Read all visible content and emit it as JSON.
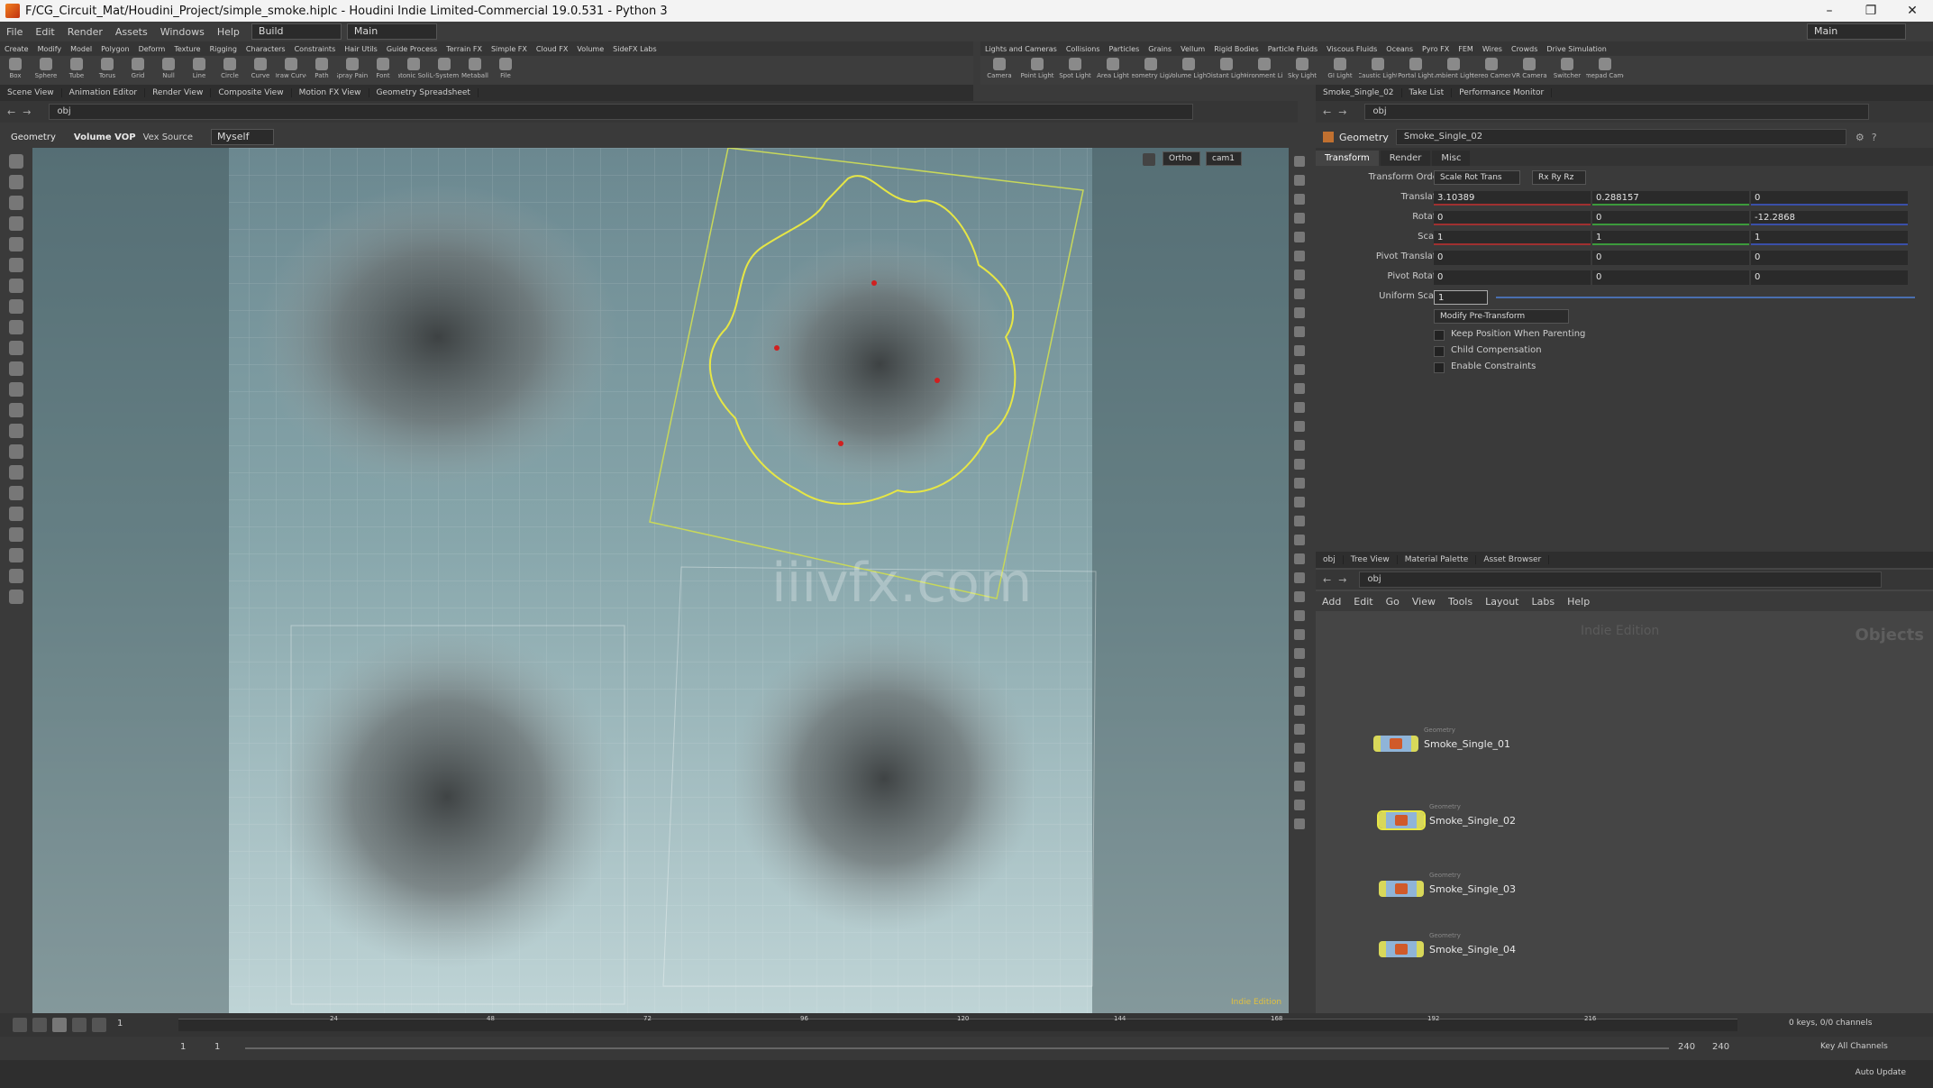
{
  "titlebar": {
    "title": "F/CG_Circuit_Mat/Houdini_Project/simple_smoke.hiplc - Houdini Indie Limited-Commercial 19.0.531 - Python 3"
  },
  "menubar": {
    "items": [
      "File",
      "Edit",
      "Render",
      "Assets",
      "Windows",
      "Help"
    ],
    "desktop": "Build",
    "desktop_main": "Main",
    "main_right": "Main"
  },
  "shelf_tabs_left": [
    "Create",
    "Modify",
    "Model",
    "Polygon",
    "Deform",
    "Texture",
    "Rigging",
    "Characters",
    "Constraints",
    "Hair Utils",
    "Guide Process",
    "Terrain FX",
    "Simple FX",
    "Cloud FX",
    "Volume",
    "SideFX Labs"
  ],
  "shelf_tabs_right": [
    "Lights and Cameras",
    "Collisions",
    "Particles",
    "Grains",
    "Vellum",
    "Rigid Bodies",
    "Particle Fluids",
    "Viscous Fluids",
    "Oceans",
    "Pyro FX",
    "FEM",
    "Wires",
    "Crowds",
    "Drive Simulation"
  ],
  "shelf_tools_left": [
    "Box",
    "Sphere",
    "Tube",
    "Torus",
    "Grid",
    "Null",
    "Line",
    "Circle",
    "Curve",
    "Draw Curve",
    "Path",
    "Spray Paint",
    "Font",
    "Platonic Solids",
    "L-System",
    "Metaball",
    "File"
  ],
  "shelf_tools_right": [
    "Camera",
    "Point Light",
    "Spot Light",
    "Area Light",
    "Geometry Light",
    "Volume Light",
    "Distant Light",
    "Environment Light",
    "Sky Light",
    "GI Light",
    "Caustic Light",
    "Portal Light",
    "Ambient Light",
    "Stereo Camera",
    "VR Camera",
    "Switcher",
    "Gamepad Camera"
  ],
  "pane_tabs_left": [
    "Scene View",
    "Animation Editor",
    "Render View",
    "Composite View",
    "Motion FX View",
    "Geometry Spreadsheet"
  ],
  "pane_tabs_right": [
    "Smoke_Single_02",
    "Take List",
    "Performance Monitor"
  ],
  "path_left": "obj",
  "path_right": "obj",
  "viewport_toolbar": {
    "context": "Geometry",
    "vop": "Volume VOP",
    "vex": "Vex Source",
    "myself": "Myself"
  },
  "viewport": {
    "view": "Ortho",
    "camera": "cam1",
    "watermark": "iiivfx.com",
    "edition": "Indie Edition"
  },
  "params": {
    "node_type": "Geometry",
    "node_name": "Smoke_Single_02",
    "tabs": [
      "Transform",
      "Render",
      "Misc"
    ],
    "transform_order_label": "Transform Order",
    "transform_order": "Scale Rot Trans",
    "rot_order": "Rx Ry Rz",
    "translate_label": "Translate",
    "translate": [
      "3.10389",
      "0.288157",
      "0"
    ],
    "rotate_label": "Rotate",
    "rotate": [
      "0",
      "0",
      "-12.2868"
    ],
    "scale_label": "Scale",
    "scale": [
      "1",
      "1",
      "1"
    ],
    "pivot_translate_label": "Pivot Translate",
    "pivot_translate": [
      "0",
      "0",
      "0"
    ],
    "pivot_rotate_label": "Pivot Rotate",
    "pivot_rotate": [
      "0",
      "0",
      "0"
    ],
    "uniform_scale_label": "Uniform Scale",
    "uniform_scale": "1",
    "modify_pre": "Modify Pre-Transform",
    "keep_position": "Keep Position When Parenting",
    "child_comp": "Child Compensation",
    "enable_constraints": "Enable Constraints"
  },
  "network": {
    "tabs": [
      "obj",
      "Tree View",
      "Material Palette",
      "Asset Browser"
    ],
    "path": "obj",
    "menu": [
      "Add",
      "Edit",
      "Go",
      "View",
      "Tools",
      "Layout",
      "Labs",
      "Help"
    ],
    "edition": "Indie Edition",
    "context_label": "Objects",
    "node_type": "Geometry",
    "nodes": [
      "Smoke_Single_01",
      "Smoke_Single_02",
      "Smoke_Single_03",
      "Smoke_Single_04"
    ]
  },
  "timeline": {
    "frame": "1",
    "ticks": [
      "24",
      "48",
      "72",
      "96",
      "120",
      "144",
      "168",
      "192",
      "216"
    ],
    "start": "1",
    "start2": "1",
    "end": "240",
    "end2": "240"
  },
  "status": {
    "keys": "0 keys, 0/0 channels",
    "key_all": "Key All Channels",
    "auto_update": "Auto Update"
  }
}
